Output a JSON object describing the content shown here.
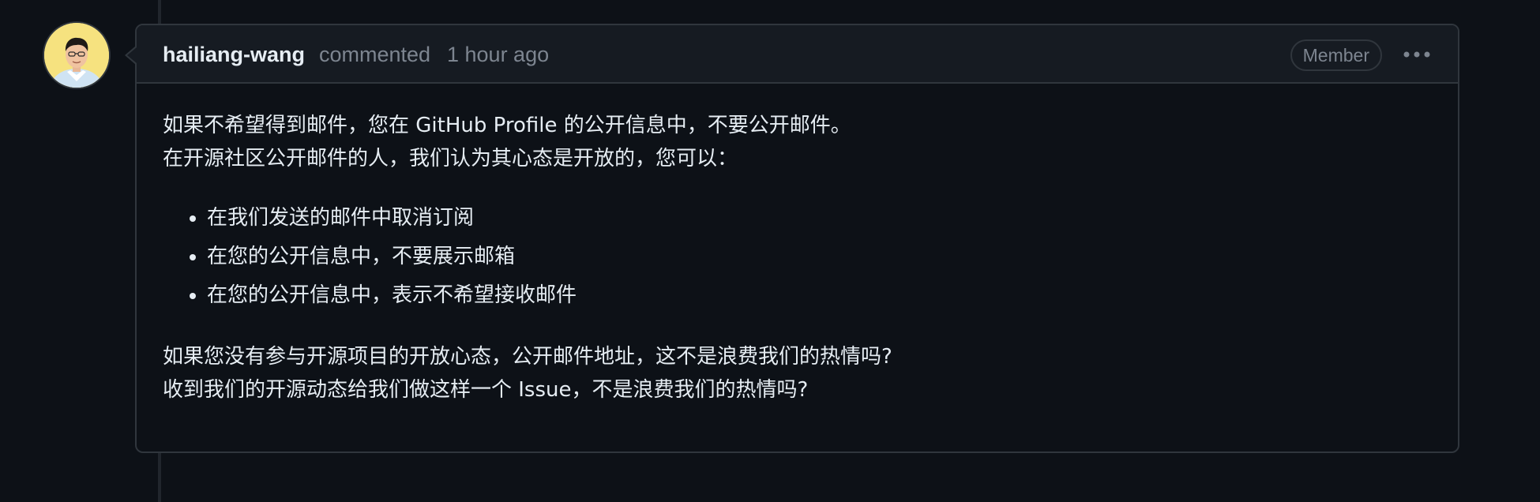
{
  "comment": {
    "author": "hailiang-wang",
    "action": "commented",
    "time": "1 hour ago",
    "role_badge": "Member",
    "body": {
      "paragraph1": [
        "如果不希望得到邮件，您在 GitHub Profile 的公开信息中，不要公开邮件。",
        "在开源社区公开邮件的人，我们认为其心态是开放的，您可以："
      ],
      "list_items": [
        "在我们发送的邮件中取消订阅",
        "在您的公开信息中，不要展示邮箱",
        "在您的公开信息中，表示不希望接收邮件"
      ],
      "paragraph2": [
        "如果您没有参与开源项目的开放心态，公开邮件地址，这不是浪费我们的热情吗?",
        "收到我们的开源动态给我们做这样一个 Issue，不是浪费我们的热情吗?"
      ]
    }
  },
  "icons": {
    "more": "kebab-horizontal-icon",
    "avatar": "user-avatar"
  },
  "colors": {
    "background": "#0d1117",
    "header_background": "#161b22",
    "border": "#30363d",
    "text_primary": "#e6edf3",
    "text_muted": "#7d8590"
  }
}
